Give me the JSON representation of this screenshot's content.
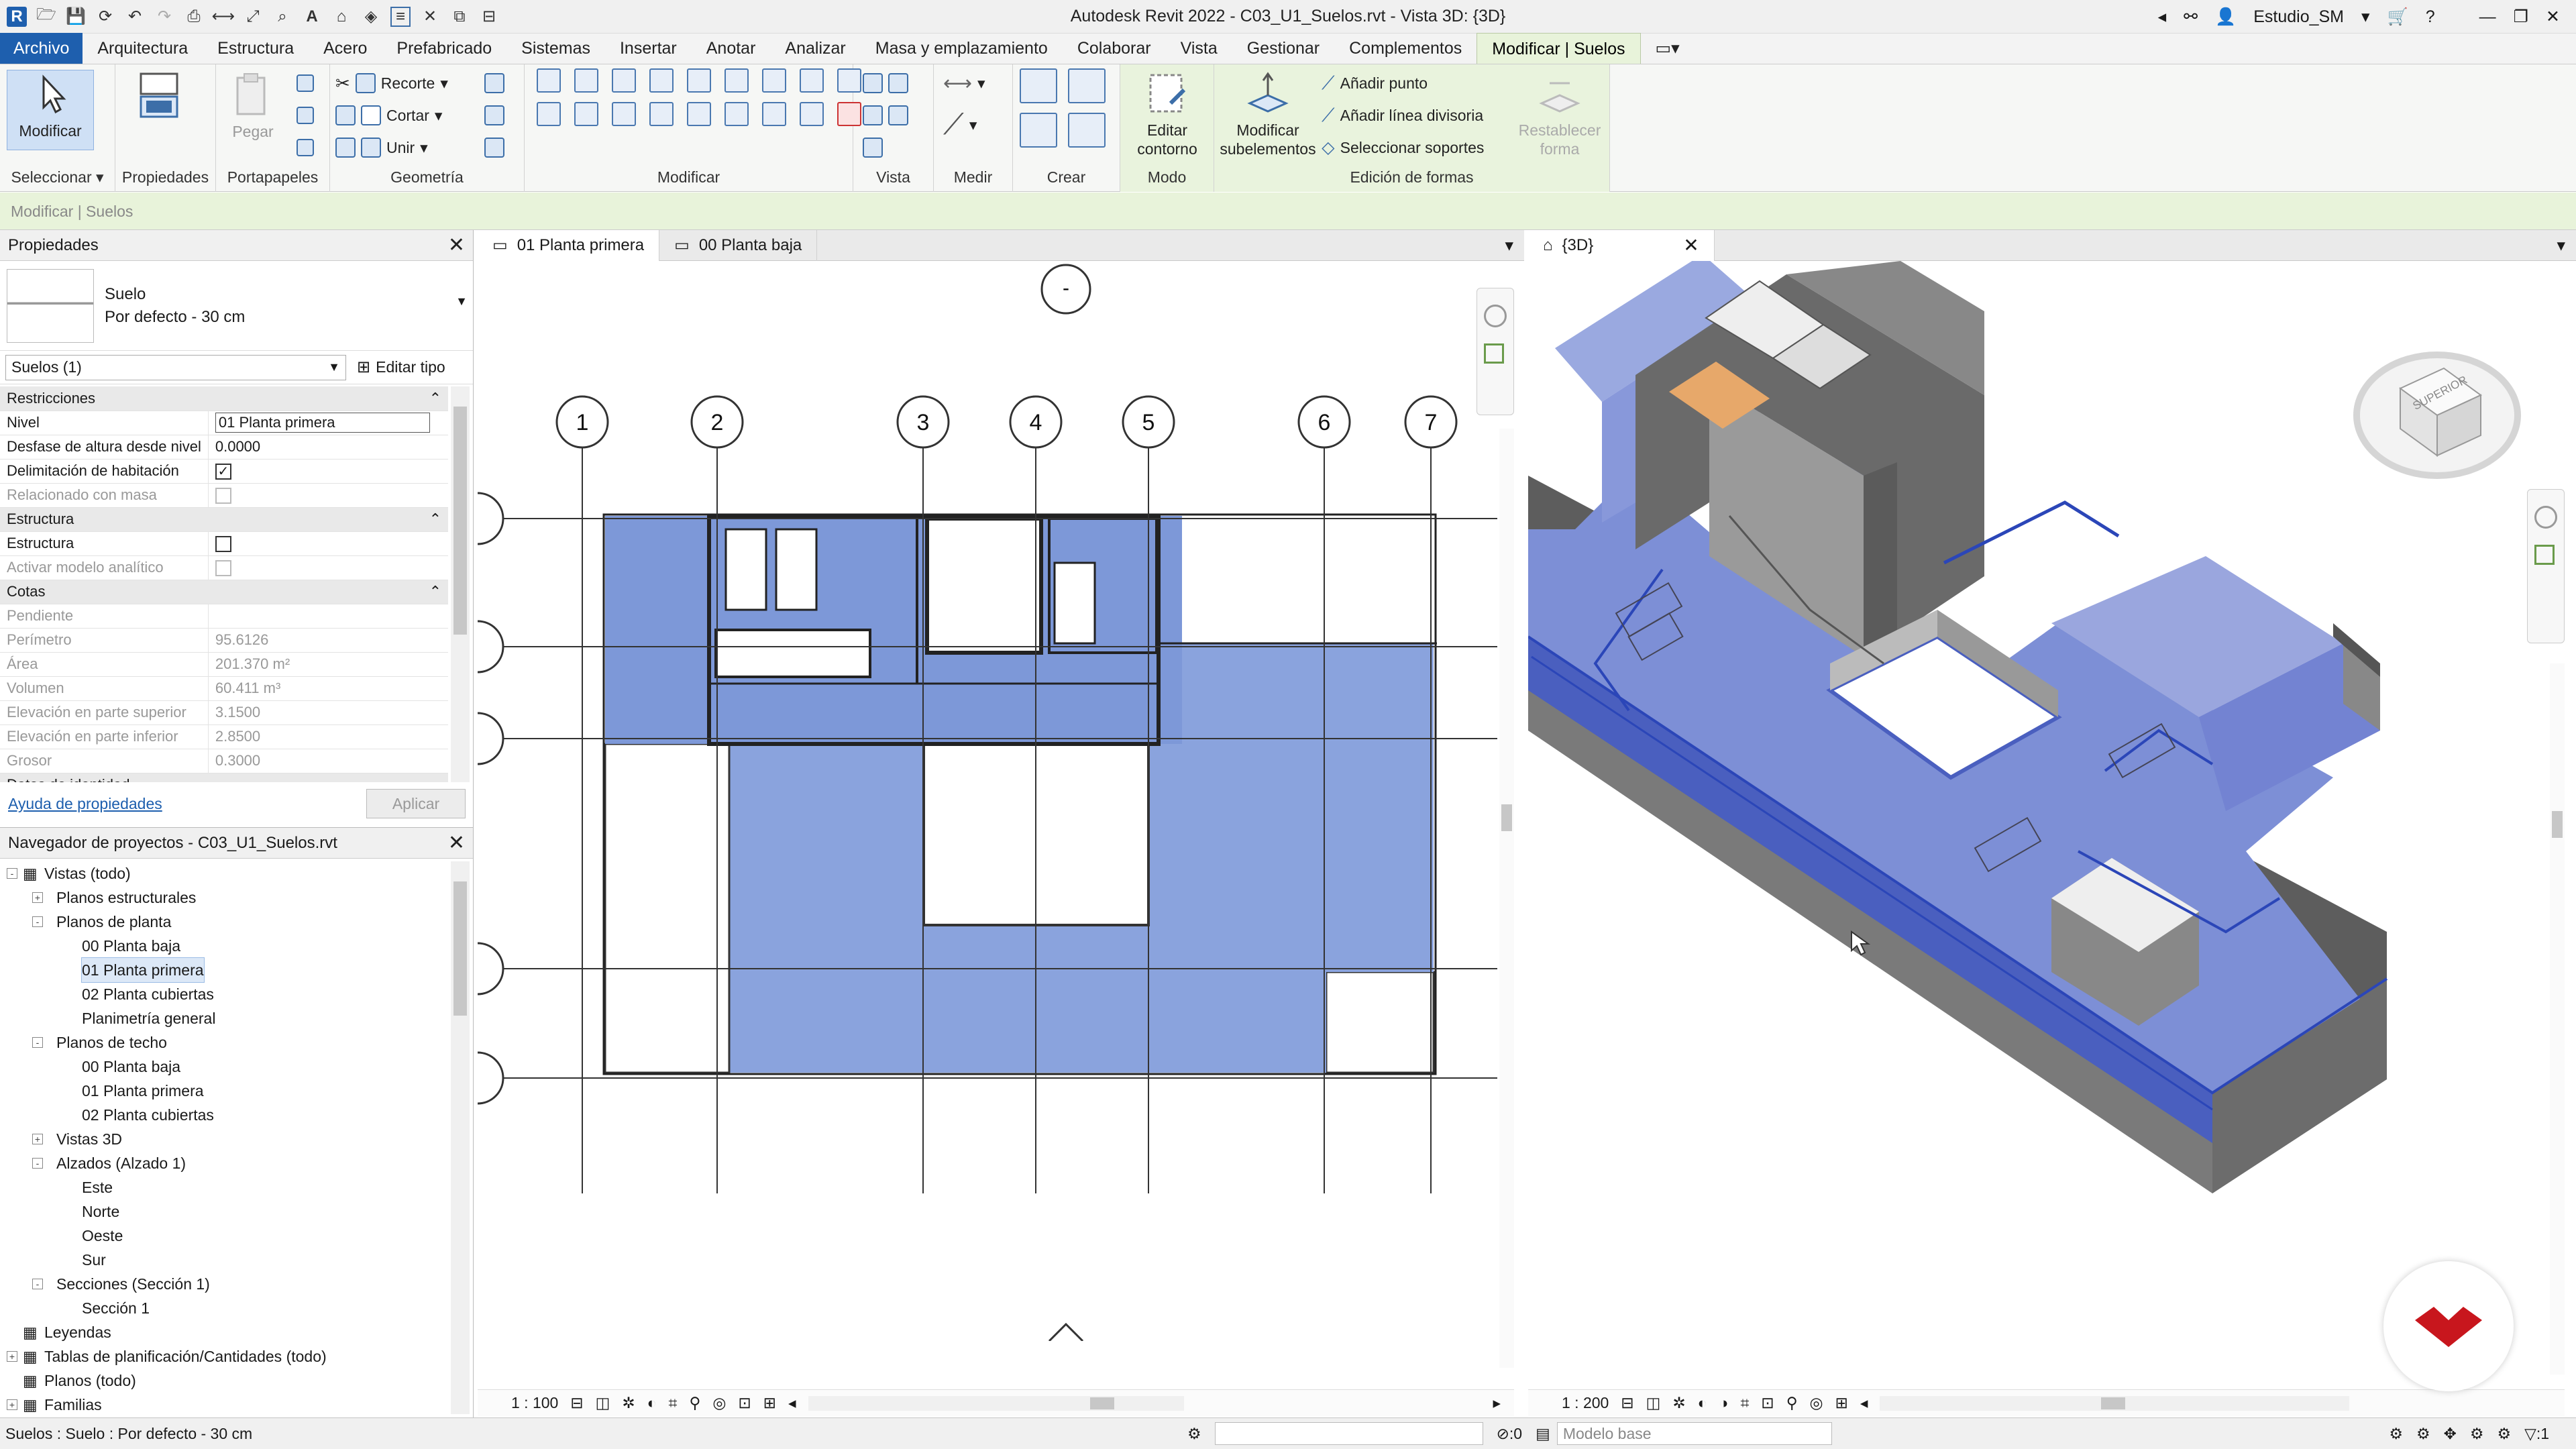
{
  "app": {
    "title": "Autodesk Revit 2022 - C03_U1_Suelos.rvt - Vista 3D: {3D}",
    "user": "Estudio_SM"
  },
  "menu": {
    "tabs": [
      "Archivo",
      "Arquitectura",
      "Estructura",
      "Acero",
      "Prefabricado",
      "Sistemas",
      "Insertar",
      "Anotar",
      "Analizar",
      "Masa y emplazamiento",
      "Colaborar",
      "Vista",
      "Gestionar",
      "Complementos",
      "Modificar | Suelos"
    ]
  },
  "ribbon": {
    "modificar": "Modificar",
    "seleccionar": "Seleccionar",
    "propiedades": "Propiedades",
    "pegar": "Pegar",
    "portapapeles": "Portapapeles",
    "recorte": "Recorte",
    "cortar": "Cortar",
    "unir": "Unir",
    "geometria": "Geometría",
    "modificar_panel": "Modificar",
    "vista": "Vista",
    "medir": "Medir",
    "crear": "Crear",
    "editar_contorno": [
      "Editar",
      "contorno"
    ],
    "modo": "Modo",
    "modificar_sub": [
      "Modificar",
      "subelementos"
    ],
    "anadir_punto": "Añadir punto",
    "anadir_linea": "Añadir línea divisoria",
    "seleccionar_soportes": "Seleccionar soportes",
    "restablecer": [
      "Restablecer",
      "forma"
    ],
    "edicion_formas": "Edición de formas"
  },
  "context_bar": "Modificar | Suelos",
  "properties": {
    "header": "Propiedades",
    "type_name": "Suelo",
    "type_sub": "Por defecto - 30 cm",
    "instance": "Suelos (1)",
    "edit_type": "Editar tipo",
    "groups": {
      "restricciones": "Restricciones",
      "estructura": "Estructura",
      "cotas": "Cotas",
      "identidad": "Datos de identidad"
    },
    "rows": {
      "nivel": [
        "Nivel",
        "01 Planta primera"
      ],
      "desfase": [
        "Desfase de altura desde nivel",
        "0.0000"
      ],
      "delim": [
        "Delimitación de habitación",
        "✓"
      ],
      "rel_masa": [
        "Relacionado con masa",
        ""
      ],
      "estructura": [
        "Estructura",
        ""
      ],
      "analitico": [
        "Activar modelo analítico",
        ""
      ],
      "pendiente": [
        "Pendiente",
        ""
      ],
      "perimetro": [
        "Perímetro",
        "95.6126"
      ],
      "area": [
        "Área",
        "201.370 m²"
      ],
      "volumen": [
        "Volumen",
        "60.411 m³"
      ],
      "elev_sup": [
        "Elevación en parte superior",
        "3.1500"
      ],
      "elev_inf": [
        "Elevación en parte inferior",
        "2.8500"
      ],
      "grosor": [
        "Grosor",
        "0.3000"
      ]
    },
    "help": "Ayuda de propiedades",
    "apply": "Aplicar"
  },
  "browser": {
    "header": "Navegador de proyectos - C03_U1_Suelos.rvt",
    "items": [
      {
        "label": "Vistas (todo)",
        "level": 0,
        "tog": "-"
      },
      {
        "label": "Planos estructurales",
        "level": 1,
        "tog": "+"
      },
      {
        "label": "Planos de planta",
        "level": 1,
        "tog": "-"
      },
      {
        "label": "00 Planta baja",
        "level": 2,
        "tog": ""
      },
      {
        "label": "01 Planta primera",
        "level": 2,
        "tog": "",
        "sel": true
      },
      {
        "label": "02 Planta cubiertas",
        "level": 2,
        "tog": ""
      },
      {
        "label": "Planimetría general",
        "level": 2,
        "tog": ""
      },
      {
        "label": "Planos de techo",
        "level": 1,
        "tog": "-"
      },
      {
        "label": "00 Planta baja",
        "level": 2,
        "tog": ""
      },
      {
        "label": "01 Planta primera",
        "level": 2,
        "tog": ""
      },
      {
        "label": "02 Planta cubiertas",
        "level": 2,
        "tog": ""
      },
      {
        "label": "Vistas 3D",
        "level": 1,
        "tog": "+"
      },
      {
        "label": "Alzados (Alzado 1)",
        "level": 1,
        "tog": "-"
      },
      {
        "label": "Este",
        "level": 2,
        "tog": ""
      },
      {
        "label": "Norte",
        "level": 2,
        "tog": ""
      },
      {
        "label": "Oeste",
        "level": 2,
        "tog": ""
      },
      {
        "label": "Sur",
        "level": 2,
        "tog": ""
      },
      {
        "label": "Secciones (Sección 1)",
        "level": 1,
        "tog": "-"
      },
      {
        "label": "Sección 1",
        "level": 2,
        "tog": ""
      },
      {
        "label": "Leyendas",
        "level": 0,
        "tog": ""
      },
      {
        "label": "Tablas de planificación/Cantidades (todo)",
        "level": 0,
        "tog": "+"
      },
      {
        "label": "Planos (todo)",
        "level": 0,
        "tog": ""
      },
      {
        "label": "Familias",
        "level": 0,
        "tog": "+"
      }
    ]
  },
  "views": {
    "tab_a": "01 Planta primera",
    "tab_b": "00 Planta baja",
    "tab_3d": "{3D}",
    "scale_plan": "1 : 100",
    "scale_3d": "1 : 200",
    "grid_labels": [
      "1",
      "2",
      "3",
      "4",
      "5",
      "6",
      "7"
    ],
    "viewcube": "SUPERIOR"
  },
  "status": {
    "text": "Suelos : Suelo : Por defecto - 30 cm",
    "count": ":0",
    "model": "Modelo base",
    "filter": ":1"
  }
}
